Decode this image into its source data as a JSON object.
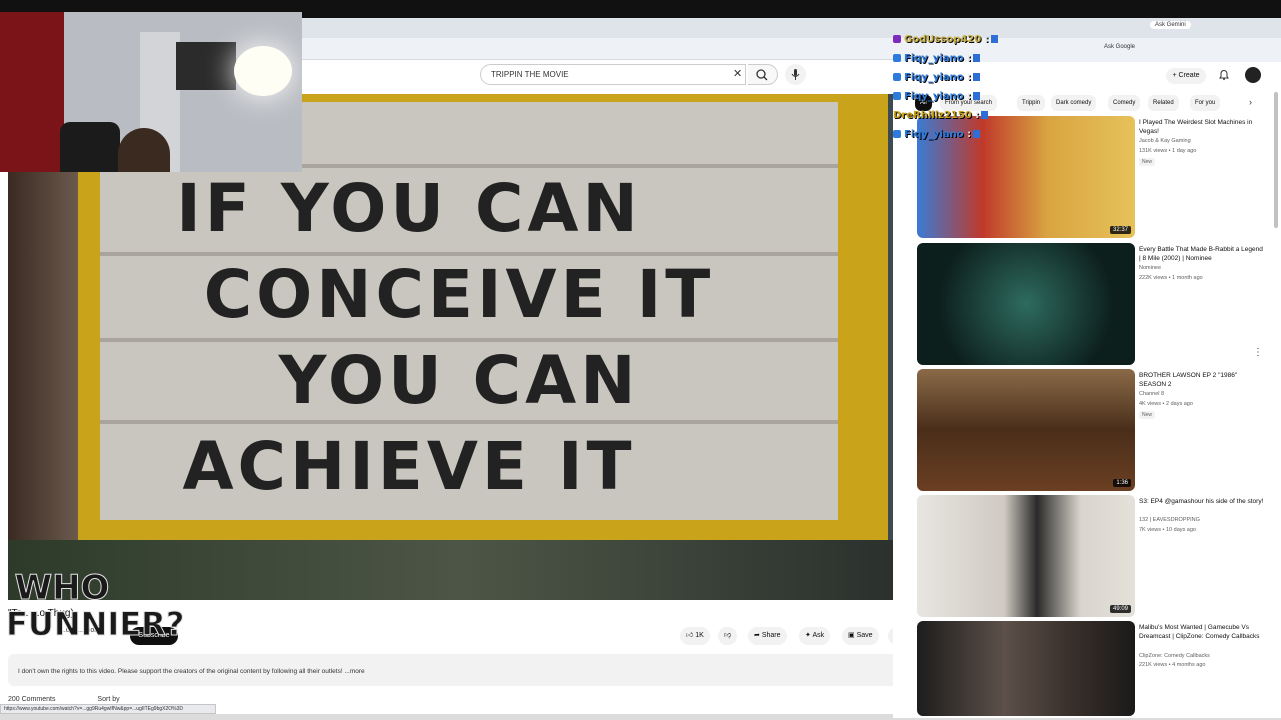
{
  "search": {
    "query": "TRIPPIN THE MOVIE"
  },
  "video": {
    "sign_lines": [
      "IF YOU CAN",
      "CONCEIVE IT",
      "YOU CAN",
      "ACHIEVE IT"
    ],
    "title": "\"Tr...           ...o Thug)",
    "channel": "...ons...ation",
    "subscribe_label": "Subscribe",
    "likes": "1K",
    "share_label": "Share",
    "ask_label": "Ask",
    "save_label": "Save",
    "description": "I don't own the rights to this video. Please support the creators of the original content by following all their outlets! ...more",
    "comments_label": "200 Comments",
    "sort_label": "Sort by",
    "status_url": "https://www.youtube.com/watch?v=...gg9Ru4gwIfNw&pp=...ugIITEg9bgX2O%3D"
  },
  "overlay_logo": {
    "line1": "WHO",
    "line2": "FUNNIER?"
  },
  "chat": [
    {
      "user": "GodUssop420",
      "color": "#c9b24a",
      "dot": "#7b2cbf"
    },
    {
      "user": "Fiqy_yiano",
      "color": "#2d7bdc",
      "dot": "#2d7bdc"
    },
    {
      "user": "Fiqy_yiano",
      "color": "#2d7bdc",
      "dot": "#2d7bdc"
    },
    {
      "user": "Fiqy_yiano",
      "color": "#2d7bdc",
      "dot": "#2d7bdc"
    },
    {
      "user": "DreRhillz2150",
      "color": "#c9a21a",
      "dot": "#c9a21a"
    },
    {
      "user": "Fiqy_yiano",
      "color": "#2d7bdc",
      "dot": "#2d7bdc"
    }
  ],
  "sidebar": {
    "ask_gemini": "Ask Gemini",
    "ask_google": "Ask Google",
    "create_label": "Create",
    "chips": [
      "All",
      "From your search",
      "Trippin",
      "Dark comedy",
      "Comedy",
      "Related",
      "For you"
    ],
    "recs": [
      {
        "title": "I Played The Weirdest Slot Machines in Vegas!",
        "channel": "Jacob & Kay Gaming",
        "views": "131K views • 1 day ago",
        "badge": "New",
        "duration": "32:37",
        "bg": "#c8962a"
      },
      {
        "title": "Every Battle That Made B-Rabbit a Legend | 8 Mile (2002) | Nominee",
        "channel": "Nominee",
        "views": "222K views • 1 month ago",
        "badge": "",
        "duration": "",
        "bg": "#15302c"
      },
      {
        "title": "BROTHER LAWSON EP 2 \"1986\" SEASON 2",
        "channel": "Channel 8",
        "views": "4K views • 2 days ago",
        "badge": "New",
        "duration": "1:36",
        "bg": "#5a3a20"
      },
      {
        "title": "S3: EP4 @gamashour his side of the story!",
        "channel": "132 | EAVESDROPPING",
        "views": "7K views • 10 days ago",
        "badge": "",
        "duration": "49:09",
        "bg": "#d9d7d2"
      },
      {
        "title": "Malibu's Most Wanted | Gamecube Vs Dreamcast | ClipZone: Comedy Callbacks",
        "channel": "ClipZone: Comedy Callbacks",
        "views": "221K views • 4 months ago",
        "badge": "",
        "duration": "",
        "bg": "#2b2b2b"
      }
    ]
  }
}
